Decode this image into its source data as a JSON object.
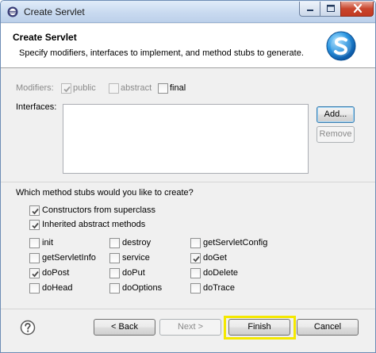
{
  "window": {
    "title": "Create Servlet"
  },
  "header": {
    "title": "Create Servlet",
    "description": "Specify modifiers, interfaces to implement, and method stubs to generate."
  },
  "modifiers": {
    "label": "Modifiers:",
    "public": {
      "label": "public",
      "checked": true,
      "enabled": false
    },
    "abstract": {
      "label": "abstract",
      "checked": false,
      "enabled": false
    },
    "final": {
      "label": "final",
      "checked": false,
      "enabled": true
    }
  },
  "interfaces": {
    "label": "Interfaces:",
    "items": [],
    "add_label": "Add...",
    "remove_label": "Remove"
  },
  "stubs": {
    "question": "Which method stubs would you like to create?",
    "constructors": {
      "label": "Constructors from superclass",
      "checked": true
    },
    "inherited": {
      "label": "Inherited abstract methods",
      "checked": true
    },
    "methods": [
      {
        "label": "init",
        "checked": false
      },
      {
        "label": "destroy",
        "checked": false
      },
      {
        "label": "getServletConfig",
        "checked": false
      },
      {
        "label": "getServletInfo",
        "checked": false
      },
      {
        "label": "service",
        "checked": false
      },
      {
        "label": "doGet",
        "checked": true
      },
      {
        "label": "doPost",
        "checked": true
      },
      {
        "label": "doPut",
        "checked": false
      },
      {
        "label": "doDelete",
        "checked": false
      },
      {
        "label": "doHead",
        "checked": false
      },
      {
        "label": "doOptions",
        "checked": false
      },
      {
        "label": "doTrace",
        "checked": false
      }
    ]
  },
  "footer": {
    "back_label": "< Back",
    "next_label": "Next >",
    "finish_label": "Finish",
    "cancel_label": "Cancel",
    "help_icon": "question-mark-icon",
    "highlight_color": "#f4e800"
  }
}
